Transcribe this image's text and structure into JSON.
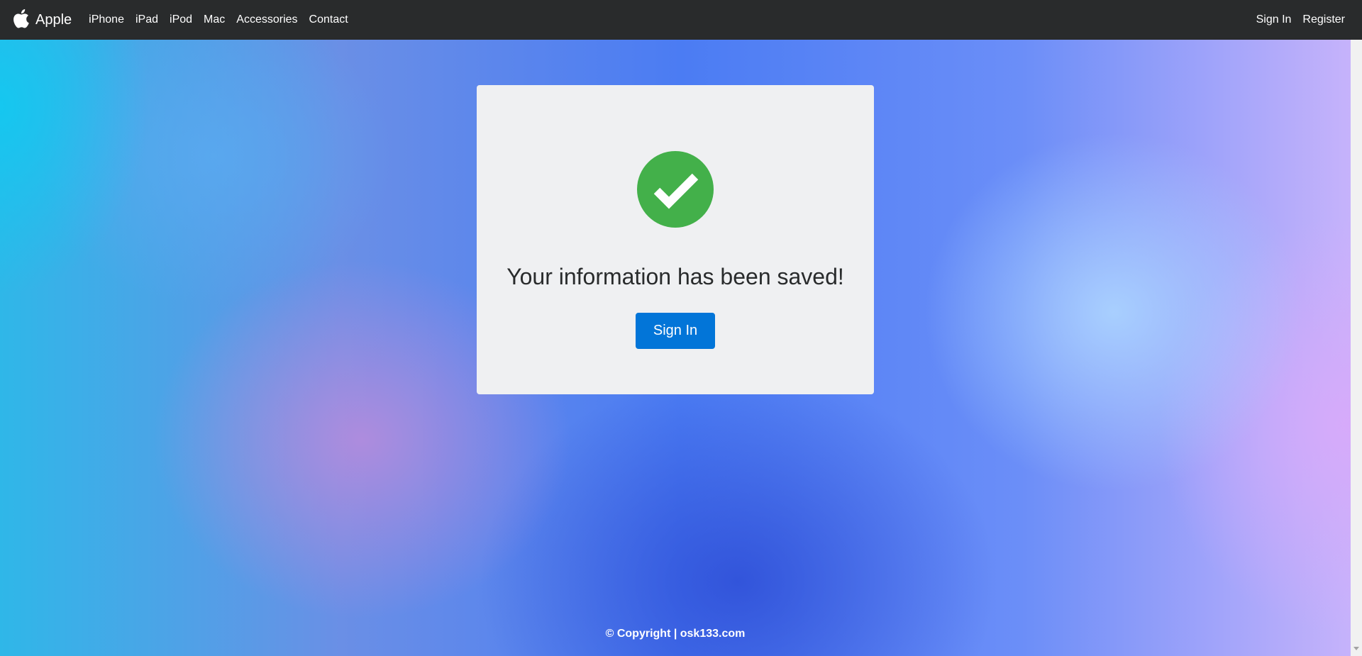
{
  "navbar": {
    "brand": "Apple",
    "links": [
      "iPhone",
      "iPad",
      "iPod",
      "Mac",
      "Accessories",
      "Contact"
    ],
    "right_links": [
      "Sign In",
      "Register"
    ]
  },
  "card": {
    "message": "Your information has been saved!",
    "button_label": "Sign In",
    "icon": "check-circle-icon",
    "icon_color": "#43b04a",
    "button_color": "#0275d8"
  },
  "footer": {
    "text": "© Copyright | osk133.com"
  },
  "colors": {
    "navbar_bg": "#292b2c",
    "card_bg": "#eff0f2"
  }
}
